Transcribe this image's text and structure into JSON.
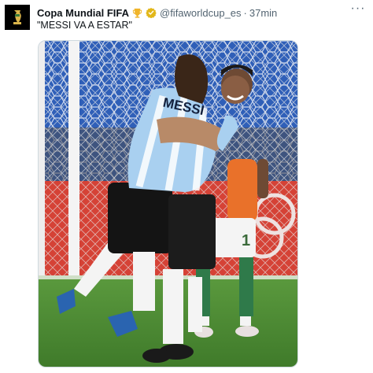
{
  "tweet": {
    "author_name": "Copa Mundial FIFA",
    "author_handle": "@fifaworldcup_es",
    "separator": "·",
    "timestamp": "37min",
    "text": "\"MESSI VA A ESTAR\"",
    "more_label": "···",
    "name_badge_icon": "trophy-icon",
    "verified_icon": "verified-badge-icon"
  },
  "media": {
    "jersey_name": "MESSI",
    "shorts_number": "1"
  },
  "colors": {
    "text_primary": "#0f1419",
    "text_secondary": "#536471",
    "verified_gold": "#e2b719",
    "pitch_green": "#4f8a35",
    "argentina_sky": "#a9d0f0",
    "olympic_red": "#d54236"
  }
}
